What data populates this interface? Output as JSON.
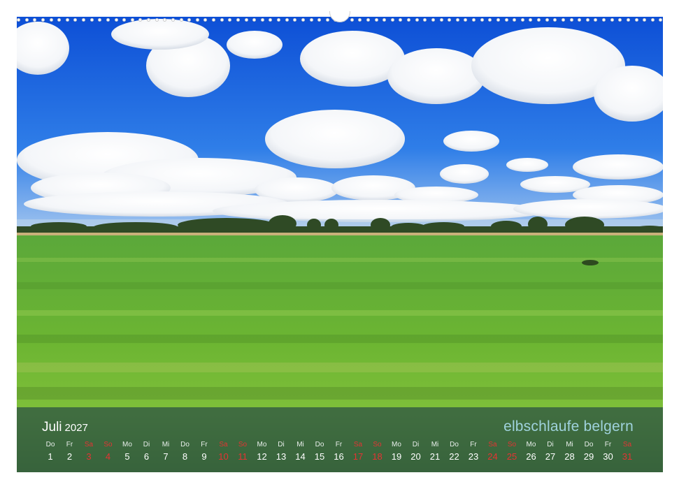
{
  "calendar": {
    "month": "Juli",
    "year": "2027",
    "brand": "elbschlaufe belgern",
    "days": [
      {
        "wd": "Do",
        "d": "1",
        "we": false
      },
      {
        "wd": "Fr",
        "d": "2",
        "we": false
      },
      {
        "wd": "Sa",
        "d": "3",
        "we": true
      },
      {
        "wd": "So",
        "d": "4",
        "we": true
      },
      {
        "wd": "Mo",
        "d": "5",
        "we": false
      },
      {
        "wd": "Di",
        "d": "6",
        "we": false
      },
      {
        "wd": "Mi",
        "d": "7",
        "we": false
      },
      {
        "wd": "Do",
        "d": "8",
        "we": false
      },
      {
        "wd": "Fr",
        "d": "9",
        "we": false
      },
      {
        "wd": "Sa",
        "d": "10",
        "we": true
      },
      {
        "wd": "So",
        "d": "11",
        "we": true
      },
      {
        "wd": "Mo",
        "d": "12",
        "we": false
      },
      {
        "wd": "Di",
        "d": "13",
        "we": false
      },
      {
        "wd": "Mi",
        "d": "14",
        "we": false
      },
      {
        "wd": "Do",
        "d": "15",
        "we": false
      },
      {
        "wd": "Fr",
        "d": "16",
        "we": false
      },
      {
        "wd": "Sa",
        "d": "17",
        "we": true
      },
      {
        "wd": "So",
        "d": "18",
        "we": true
      },
      {
        "wd": "Mo",
        "d": "19",
        "we": false
      },
      {
        "wd": "Di",
        "d": "20",
        "we": false
      },
      {
        "wd": "Mi",
        "d": "21",
        "we": false
      },
      {
        "wd": "Do",
        "d": "22",
        "we": false
      },
      {
        "wd": "Fr",
        "d": "23",
        "we": false
      },
      {
        "wd": "Sa",
        "d": "24",
        "we": true
      },
      {
        "wd": "So",
        "d": "25",
        "we": true
      },
      {
        "wd": "Mo",
        "d": "26",
        "we": false
      },
      {
        "wd": "Di",
        "d": "27",
        "we": false
      },
      {
        "wd": "Mi",
        "d": "28",
        "we": false
      },
      {
        "wd": "Do",
        "d": "29",
        "we": false
      },
      {
        "wd": "Fr",
        "d": "30",
        "we": false
      },
      {
        "wd": "Sa",
        "d": "31",
        "we": true
      }
    ]
  },
  "colors": {
    "sky": "#1b63e0",
    "grass": "#5ea836",
    "band": "#284e42",
    "weekend": "#e53333",
    "brand_text": "#9fd2dc"
  }
}
